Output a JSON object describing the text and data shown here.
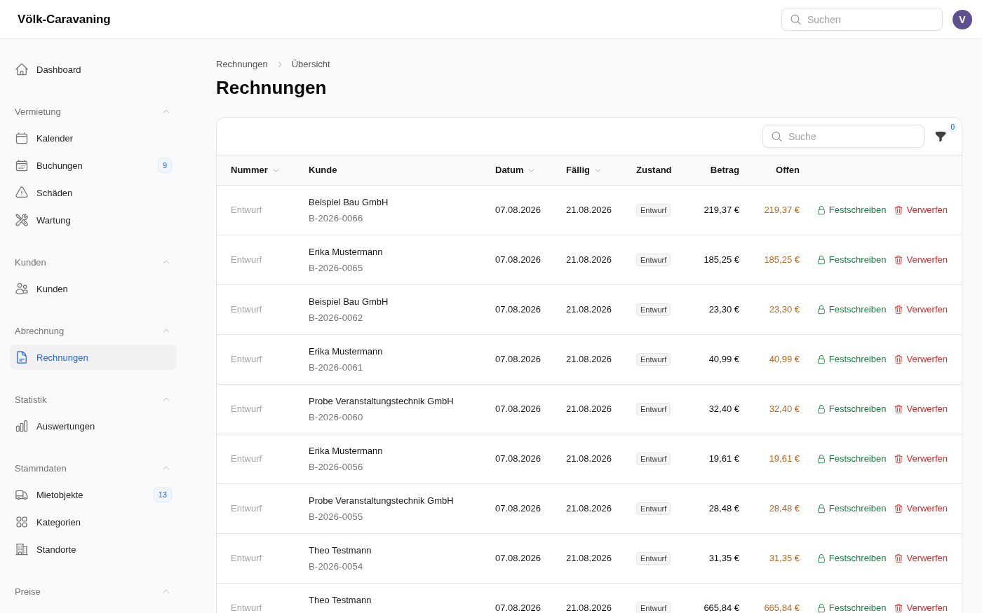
{
  "app": {
    "title": "Völk-Caravaning",
    "search": {
      "placeholder": "Suchen"
    },
    "avatar": "V"
  },
  "sidebar": {
    "items": [
      {
        "label": "Dashboard",
        "selected": false
      }
    ],
    "sections": [
      {
        "title": "Vermietung",
        "expanded": true,
        "items": [
          {
            "label": "Kalender",
            "selected": false
          },
          {
            "label": "Buchungen",
            "badge": "9",
            "selected": false
          },
          {
            "label": "Schäden",
            "selected": false
          },
          {
            "label": "Wartung",
            "selected": false
          }
        ]
      },
      {
        "title": "Kunden",
        "expanded": true,
        "items": [
          {
            "label": "Kunden",
            "selected": false
          }
        ]
      },
      {
        "title": "Abrechnung",
        "expanded": true,
        "items": [
          {
            "label": "Rechnungen",
            "selected": true
          }
        ]
      },
      {
        "title": "Statistik",
        "expanded": true,
        "items": [
          {
            "label": "Auswertungen",
            "selected": false
          }
        ]
      },
      {
        "title": "Stammdaten",
        "expanded": true,
        "items": [
          {
            "label": "Mietobjekte",
            "badge": "13",
            "selected": false
          },
          {
            "label": "Kategorien",
            "selected": false
          },
          {
            "label": "Standorte",
            "selected": false
          }
        ]
      },
      {
        "title": "Preise",
        "expanded": true
      }
    ]
  },
  "breadcrumb": [
    "Rechnungen",
    "Übersicht"
  ],
  "page_title": "Rechnungen",
  "table": {
    "search": {
      "placeholder": "Suche"
    },
    "filter_count": "0",
    "columns": [
      {
        "label": "Nummer",
        "sortable": true
      },
      {
        "label": "Kunde",
        "sortable": false
      },
      {
        "label": "Datum",
        "sortable": true
      },
      {
        "label": "Fällig",
        "sortable": true
      },
      {
        "label": "Zustand",
        "sortable": false
      },
      {
        "label": "Betrag",
        "sortable": false
      },
      {
        "label": "Offen",
        "sortable": false
      }
    ],
    "rows": [
      {
        "number": "Entwurf",
        "customer": "Beispiel Bau GmbH",
        "reference": "B-2026-0066",
        "date": "07.08.2026",
        "due": "21.08.2026",
        "status": "Entwurf",
        "amount": "219,37 €",
        "open": "219,37 €",
        "actions": [
          {
            "kind": "commit",
            "label": "Festschreiben"
          },
          {
            "kind": "discard",
            "label": "Verwerfen"
          }
        ]
      },
      {
        "number": "Entwurf",
        "customer": "Erika Mustermann",
        "reference": "B-2026-0065",
        "date": "07.08.2026",
        "due": "21.08.2026",
        "status": "Entwurf",
        "amount": "185,25 €",
        "open": "185,25 €",
        "actions": [
          {
            "kind": "commit",
            "label": "Festschreiben"
          },
          {
            "kind": "discard",
            "label": "Verwerfen"
          }
        ]
      },
      {
        "number": "Entwurf",
        "customer": "Beispiel Bau GmbH",
        "reference": "B-2026-0062",
        "date": "07.08.2026",
        "due": "21.08.2026",
        "status": "Entwurf",
        "amount": "23,30 €",
        "open": "23,30 €",
        "actions": [
          {
            "kind": "commit",
            "label": "Festschreiben"
          },
          {
            "kind": "discard",
            "label": "Verwerfen"
          }
        ]
      },
      {
        "number": "Entwurf",
        "customer": "Erika Mustermann",
        "reference": "B-2026-0061",
        "date": "07.08.2026",
        "due": "21.08.2026",
        "status": "Entwurf",
        "amount": "40,99 €",
        "open": "40,99 €",
        "actions": [
          {
            "kind": "commit",
            "label": "Festschreiben"
          },
          {
            "kind": "discard",
            "label": "Verwerfen"
          }
        ]
      },
      {
        "number": "Entwurf",
        "customer": "Probe Veranstaltungstechnik GmbH",
        "reference": "B-2026-0060",
        "date": "07.08.2026",
        "due": "21.08.2026",
        "status": "Entwurf",
        "amount": "32,40 €",
        "open": "32,40 €",
        "actions": [
          {
            "kind": "commit",
            "label": "Festschreiben"
          },
          {
            "kind": "discard",
            "label": "Verwerfen"
          }
        ]
      },
      {
        "number": "Entwurf",
        "customer": "Erika Mustermann",
        "reference": "B-2026-0056",
        "date": "07.08.2026",
        "due": "21.08.2026",
        "status": "Entwurf",
        "amount": "19,61 €",
        "open": "19,61 €",
        "actions": [
          {
            "kind": "commit",
            "label": "Festschreiben"
          },
          {
            "kind": "discard",
            "label": "Verwerfen"
          }
        ]
      },
      {
        "number": "Entwurf",
        "customer": "Probe Veranstaltungstechnik GmbH",
        "reference": "B-2026-0055",
        "date": "07.08.2026",
        "due": "21.08.2026",
        "status": "Entwurf",
        "amount": "28,48 €",
        "open": "28,48 €",
        "actions": [
          {
            "kind": "commit",
            "label": "Festschreiben"
          },
          {
            "kind": "discard",
            "label": "Verwerfen"
          }
        ]
      },
      {
        "number": "Entwurf",
        "customer": "Theo Testmann",
        "reference": "B-2026-0054",
        "date": "07.08.2026",
        "due": "21.08.2026",
        "status": "Entwurf",
        "amount": "31,35 €",
        "open": "31,35 €",
        "actions": [
          {
            "kind": "commit",
            "label": "Festschreiben"
          },
          {
            "kind": "discard",
            "label": "Verwerfen"
          }
        ]
      },
      {
        "number": "Entwurf",
        "customer": "Theo Testmann",
        "date": "07.08.2026",
        "due": "21.08.2026",
        "status": "Entwurf",
        "amount": "665,84 €",
        "open": "665,84 €",
        "actions": [
          {
            "kind": "commit",
            "label": "Festschreiben"
          },
          {
            "kind": "discard",
            "label": "Verwerfen"
          }
        ]
      }
    ]
  }
}
